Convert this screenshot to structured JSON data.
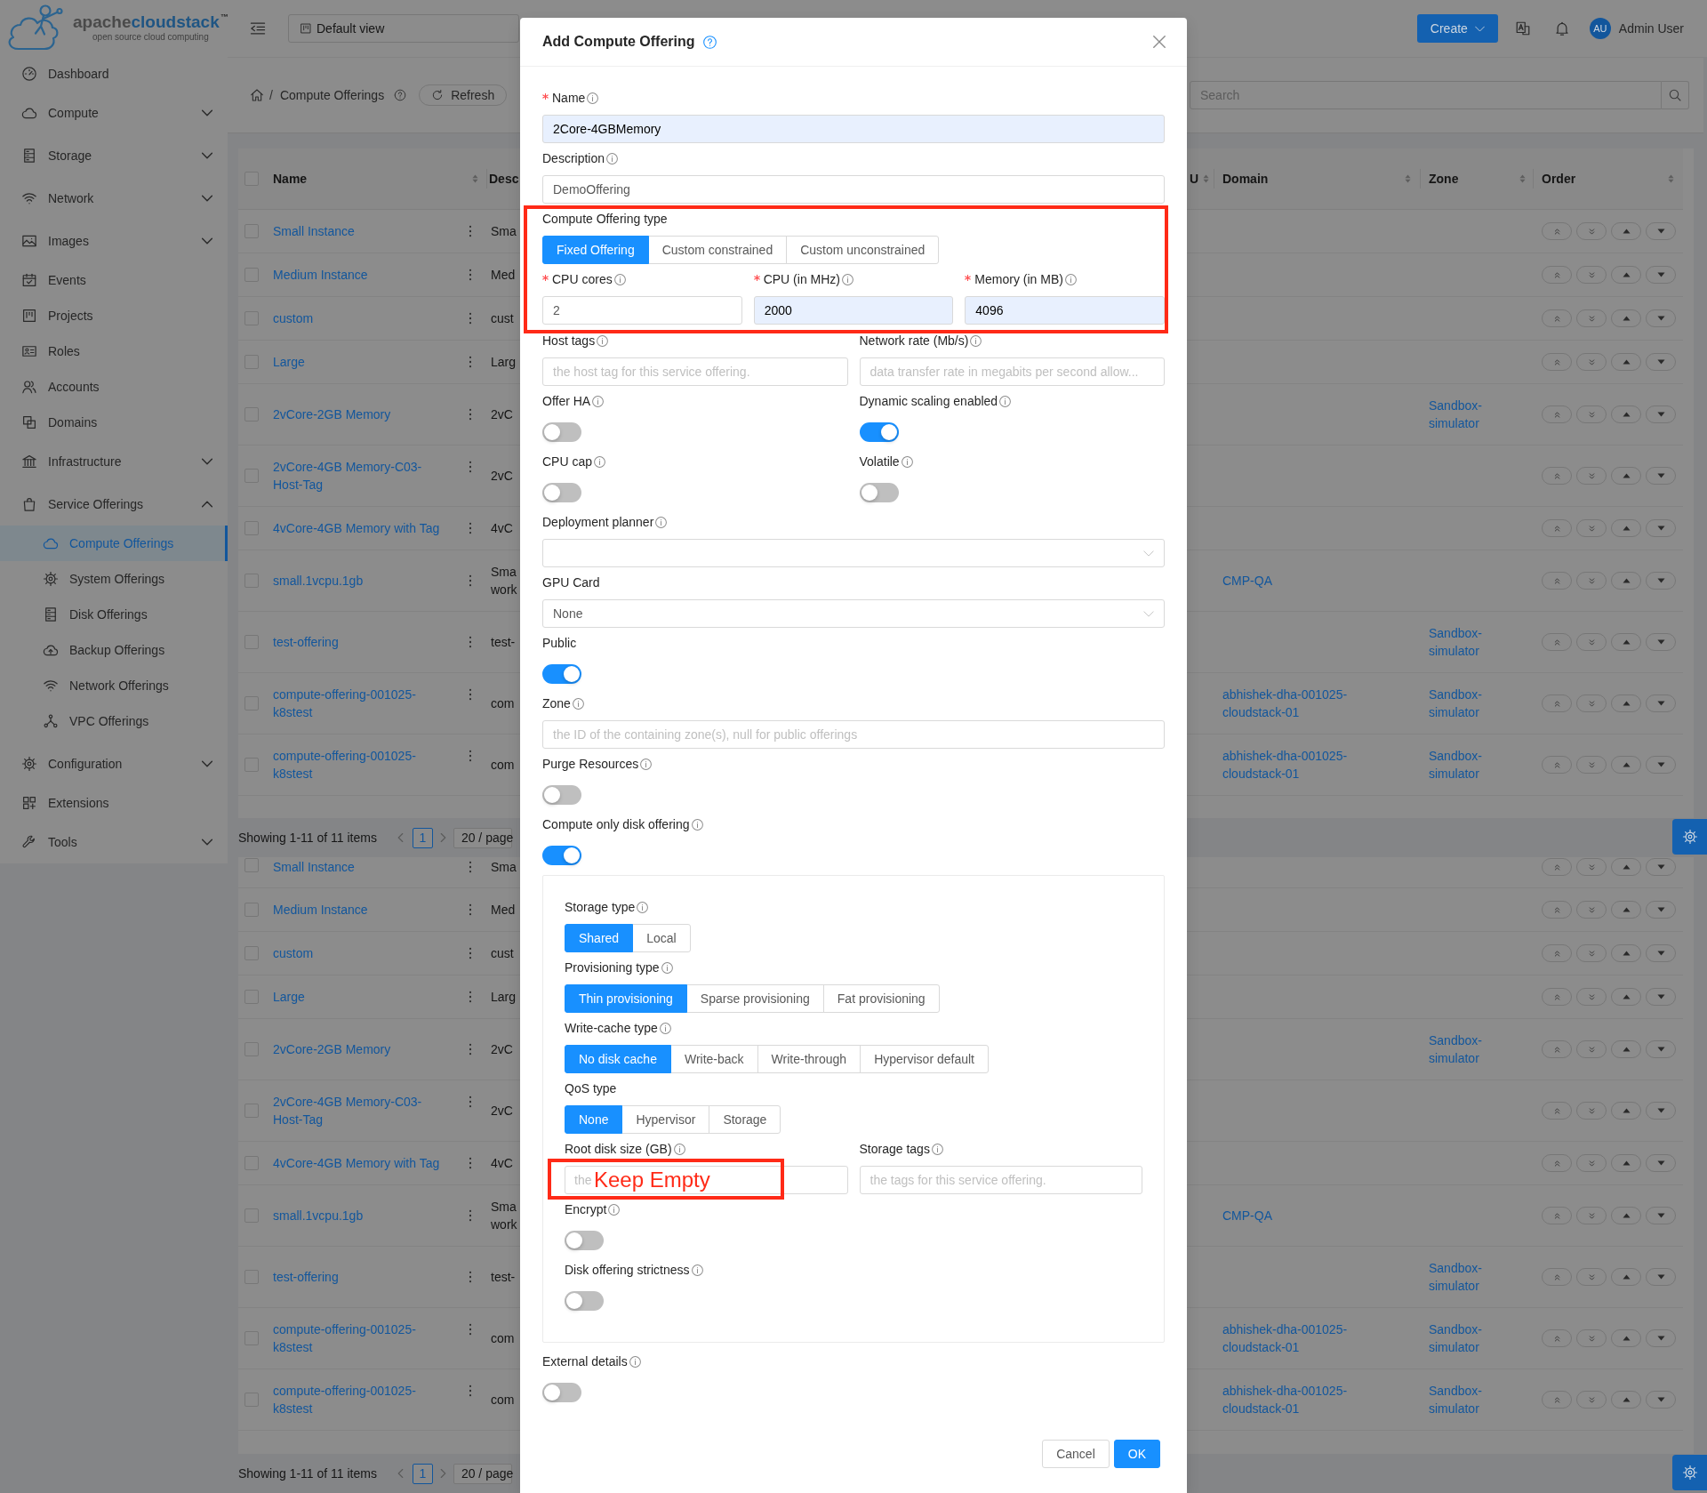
{
  "sidebar": {
    "logo": {
      "wordmark": [
        "apache",
        "cloudstack",
        "™"
      ],
      "tagline": "open source cloud computing"
    },
    "items": [
      {
        "kind": "item",
        "label": "Dashboard",
        "selected": false
      },
      {
        "kind": "group",
        "label": "Compute",
        "selected": false,
        "expanded": false
      },
      {
        "kind": "group",
        "label": "Storage",
        "selected": false,
        "expanded": false
      },
      {
        "kind": "group",
        "label": "Network",
        "selected": false,
        "expanded": false
      },
      {
        "kind": "group",
        "label": "Images",
        "selected": false,
        "expanded": false
      },
      {
        "kind": "item",
        "label": "Events",
        "selected": false
      },
      {
        "kind": "item",
        "label": "Projects",
        "selected": false
      },
      {
        "kind": "item",
        "label": "Roles",
        "selected": false
      },
      {
        "kind": "item",
        "label": "Accounts",
        "selected": false
      },
      {
        "kind": "item",
        "label": "Domains",
        "selected": false
      },
      {
        "kind": "group",
        "label": "Infrastructure",
        "selected": false,
        "expanded": false
      },
      {
        "kind": "group",
        "label": "Service Offerings",
        "selected": false,
        "expanded": true,
        "children": [
          {
            "label": "Compute Offerings",
            "selected": true
          },
          {
            "label": "System Offerings",
            "selected": false
          },
          {
            "label": "Disk Offerings",
            "selected": false
          },
          {
            "label": "Backup Offerings",
            "selected": false
          },
          {
            "label": "Network Offerings",
            "selected": false
          },
          {
            "label": "VPC Offerings",
            "selected": false
          }
        ]
      },
      {
        "kind": "group",
        "label": "Configuration",
        "selected": false,
        "expanded": false
      },
      {
        "kind": "item",
        "label": "Extensions",
        "selected": false
      },
      {
        "kind": "group",
        "label": "Tools",
        "selected": false,
        "expanded": false
      }
    ]
  },
  "header": {
    "view_select": {
      "value": "Default view"
    },
    "create_button": "Create",
    "user": {
      "initials": "AU",
      "name": "Admin User"
    }
  },
  "breadcrumb": {
    "separator": "/",
    "current": "Compute Offerings",
    "refresh_button": "Refresh"
  },
  "search": {
    "placeholder": "Search"
  },
  "table": {
    "header_checkbox": {
      "checked": false
    },
    "columns": [
      {
        "label": "Name"
      },
      {
        "label": "Desc"
      },
      {
        "label": "U"
      },
      {
        "label": "Domain"
      },
      {
        "label": "Zone"
      },
      {
        "label": "Order"
      }
    ],
    "rows": [
      {
        "checked": false,
        "name": "Small Instance",
        "description": "Sma"
      },
      {
        "checked": false,
        "name": "Medium Instance",
        "description": "Med"
      },
      {
        "checked": false,
        "name": "custom",
        "description": "cust"
      },
      {
        "checked": false,
        "name": "Large",
        "description": "Larg"
      },
      {
        "checked": false,
        "name": "2vCore-2GB Memory",
        "description": "2vC",
        "zone": "Sandbox-simulator"
      },
      {
        "checked": false,
        "name": "2vCore-4GB Memory-C03-Host-Tag",
        "description": "2vC"
      },
      {
        "checked": false,
        "name": "4vCore-4GB Memory with Tag",
        "description": "4vC"
      },
      {
        "checked": false,
        "name": "small.1vcpu.1gb",
        "description": "Sma work",
        "domain": "CMP-QA"
      },
      {
        "checked": false,
        "name": "test-offering",
        "description": "test-",
        "zone": "Sandbox-simulator"
      },
      {
        "checked": false,
        "name": "compute-offering-001025-k8stest",
        "description": "com",
        "domain": "abhishek-dha-001025-cloudstack-01",
        "zone": "Sandbox-simulator"
      },
      {
        "checked": false,
        "name": "compute-offering-001025-k8stest",
        "description": "com",
        "domain": "abhishek-dha-001025-cloudstack-01",
        "zone": "Sandbox-simulator"
      }
    ]
  },
  "pagination": {
    "summary": "Showing 1-11 of 11 items",
    "pages": [
      {
        "label": "1",
        "selected": true
      }
    ],
    "page_size": "20 / page"
  },
  "table_continued": {
    "rows": [
      {
        "checked": false,
        "name": "Small Instance",
        "description": "Sma"
      },
      {
        "checked": false,
        "name": "Medium Instance",
        "description": "Med"
      },
      {
        "checked": false,
        "name": "custom",
        "description": "cust"
      },
      {
        "checked": false,
        "name": "Large",
        "description": "Larg"
      },
      {
        "checked": false,
        "name": "2vCore-2GB Memory",
        "description": "2vC",
        "zone": "Sandbox-simulator"
      },
      {
        "checked": false,
        "name": "2vCore-4GB Memory-C03-Host-Tag",
        "description": "2vC"
      },
      {
        "checked": false,
        "name": "4vCore-4GB Memory with Tag",
        "description": "4vC"
      },
      {
        "checked": false,
        "name": "small.1vcpu.1gb",
        "description": "Sma work",
        "domain": "CMP-QA"
      },
      {
        "checked": false,
        "name": "test-offering",
        "description": "test-",
        "zone": "Sandbox-simulator"
      },
      {
        "checked": false,
        "name": "compute-offering-001025-k8stest",
        "description": "com",
        "domain": "abhishek-dha-001025-cloudstack-01",
        "zone": "Sandbox-simulator"
      },
      {
        "checked": false,
        "name": "compute-offering-001025-k8stest",
        "description": "com",
        "domain": "abhishek-dha-001025-cloudstack-01",
        "zone": "Sandbox-simulator"
      }
    ]
  },
  "pagination_continued": {
    "summary": "Showing 1-11 of 11 items",
    "pages": [
      {
        "label": "1",
        "selected": true
      }
    ],
    "page_size": "20 / page"
  },
  "modal": {
    "title": "Add Compute Offering",
    "items": [
      {
        "kind": "input",
        "label": "Name",
        "required": true,
        "has_info": true,
        "value": "2Core-4GBMemory",
        "autofilled": true
      },
      {
        "kind": "input",
        "label": "Description",
        "required": false,
        "has_info": true,
        "value": "DemoOffering",
        "autofilled": false
      },
      {
        "kind": "highlight",
        "items": [
          {
            "kind": "radio",
            "label": "Compute Offering type",
            "required": false,
            "has_info": false,
            "options": [
              {
                "label": "Fixed Offering",
                "selected": true
              },
              {
                "label": "Custom constrained",
                "selected": false
              },
              {
                "label": "Custom unconstrained",
                "selected": false
              }
            ]
          },
          {
            "kind": "columns",
            "items": [
              {
                "kind": "input",
                "label": "CPU cores",
                "required": true,
                "has_info": true,
                "value": "2",
                "autofilled": false
              },
              {
                "kind": "input",
                "label": "CPU (in MHz)",
                "required": true,
                "has_info": true,
                "value": "2000",
                "autofilled": true
              },
              {
                "kind": "input",
                "label": "Memory (in MB)",
                "required": true,
                "has_info": true,
                "value": "4096",
                "autofilled": true
              }
            ]
          }
        ]
      },
      {
        "kind": "columns",
        "items": [
          {
            "kind": "input",
            "label": "Host tags",
            "required": false,
            "has_info": true,
            "placeholder": "the host tag for this service offering."
          },
          {
            "kind": "input",
            "label": "Network rate (Mb/s)",
            "required": false,
            "has_info": true,
            "placeholder": "data transfer rate in megabits per second allow..."
          }
        ]
      },
      {
        "kind": "columns",
        "items": [
          {
            "kind": "switch",
            "label": "Offer HA",
            "required": false,
            "has_info": true,
            "on": false
          },
          {
            "kind": "switch",
            "label": "Dynamic scaling enabled",
            "required": false,
            "has_info": true,
            "on": true
          }
        ]
      },
      {
        "kind": "columns",
        "items": [
          {
            "kind": "switch",
            "label": "CPU cap",
            "required": false,
            "has_info": true,
            "on": false
          },
          {
            "kind": "switch",
            "label": "Volatile",
            "required": false,
            "has_info": true,
            "on": false
          }
        ]
      },
      {
        "kind": "select",
        "label": "Deployment planner",
        "required": false,
        "has_info": true
      },
      {
        "kind": "select",
        "label": "GPU Card",
        "required": false,
        "has_info": false,
        "value": "None"
      },
      {
        "kind": "switch",
        "label": "Public",
        "required": false,
        "has_info": false,
        "on": true
      },
      {
        "kind": "input",
        "label": "Zone",
        "required": false,
        "has_info": true,
        "placeholder": "the ID of the containing zone(s), null for public offerings"
      },
      {
        "kind": "switch",
        "label": "Purge Resources",
        "required": false,
        "has_info": true,
        "on": false
      },
      {
        "kind": "switch",
        "label": "Compute only disk offering",
        "required": false,
        "has_info": true,
        "on": true
      },
      {
        "kind": "panel",
        "items": [
          {
            "kind": "radio",
            "label": "Storage type",
            "required": false,
            "has_info": true,
            "options": [
              {
                "label": "Shared",
                "selected": true
              },
              {
                "label": "Local",
                "selected": false
              }
            ]
          },
          {
            "kind": "radio",
            "label": "Provisioning type",
            "required": false,
            "has_info": true,
            "options": [
              {
                "label": "Thin provisioning",
                "selected": true
              },
              {
                "label": "Sparse provisioning",
                "selected": false
              },
              {
                "label": "Fat provisioning",
                "selected": false
              }
            ]
          },
          {
            "kind": "radio",
            "label": "Write-cache type",
            "required": false,
            "has_info": true,
            "options": [
              {
                "label": "No disk cache",
                "selected": true
              },
              {
                "label": "Write-back",
                "selected": false
              },
              {
                "label": "Write-through",
                "selected": false
              },
              {
                "label": "Hypervisor default",
                "selected": false
              }
            ]
          },
          {
            "kind": "radio",
            "label": "QoS type",
            "required": false,
            "has_info": false,
            "options": [
              {
                "label": "None",
                "selected": true
              },
              {
                "label": "Hypervisor",
                "selected": false
              },
              {
                "label": "Storage",
                "selected": false
              }
            ]
          },
          {
            "kind": "columns",
            "items": [
              {
                "kind": "input",
                "label": "Root disk size (GB)",
                "required": false,
                "has_info": true,
                "placeholder": "the",
                "annotation": "Keep Empty"
              },
              {
                "kind": "input",
                "label": "Storage tags",
                "required": false,
                "has_info": true,
                "placeholder": "the tags for this service offering."
              }
            ]
          },
          {
            "kind": "switch",
            "label": "Encrypt",
            "required": false,
            "has_info": true,
            "on": false
          },
          {
            "kind": "switch",
            "label": "Disk offering strictness",
            "required": false,
            "has_info": true,
            "on": false
          }
        ]
      },
      {
        "kind": "switch",
        "label": "External details",
        "required": false,
        "has_info": true,
        "on": false
      }
    ],
    "buttons": [
      {
        "label": "Cancel",
        "primary": false
      },
      {
        "label": "OK",
        "primary": true
      }
    ]
  }
}
